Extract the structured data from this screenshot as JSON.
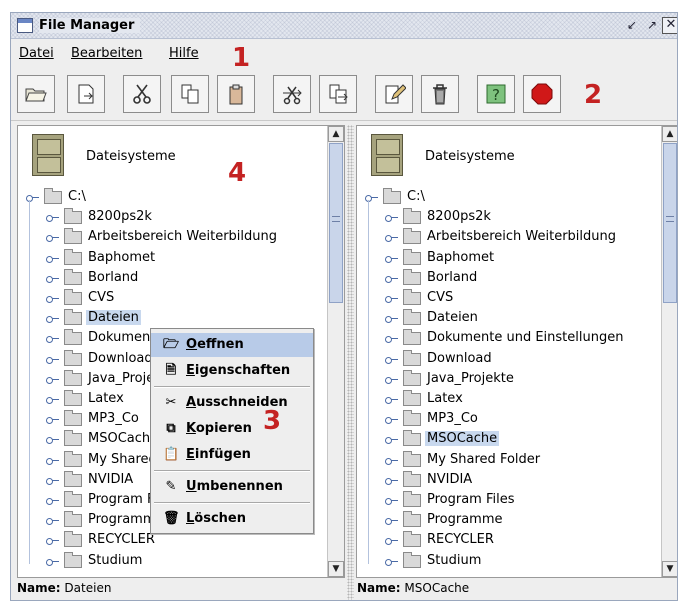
{
  "window": {
    "title": "File Manager"
  },
  "menubar": {
    "items": [
      {
        "label": "Datei"
      },
      {
        "label": "Bearbeiten"
      },
      {
        "label": "Hilfe"
      }
    ]
  },
  "callouts": [
    "1",
    "2",
    "3",
    "4"
  ],
  "toolbar": {
    "buttons": [
      {
        "icon": "open-folder-icon"
      },
      {
        "icon": "properties-icon"
      },
      {
        "icon": "cut-icon"
      },
      {
        "icon": "copy-icon"
      },
      {
        "icon": "paste-icon"
      },
      {
        "icon": "move-icon"
      },
      {
        "icon": "copy-to-icon"
      },
      {
        "icon": "rename-icon"
      },
      {
        "icon": "delete-icon"
      },
      {
        "icon": "help-icon"
      },
      {
        "icon": "stop-icon"
      }
    ]
  },
  "left_pane": {
    "root_label": "Dateisysteme",
    "drive": "C:\\",
    "folders": [
      "8200ps2k",
      "Arbeitsbereich Weiterbildung",
      "Baphomet",
      "Borland",
      "CVS",
      "Dateien",
      "Dokumente und Einstellungen",
      "Download",
      "Java_Projekte",
      "Latex",
      "MP3_Co",
      "MSOCache",
      "My Shared Folder",
      "NVIDIA",
      "Program Files",
      "Programme",
      "RECYCLER",
      "Studium"
    ],
    "selected": "Dateien",
    "status_label": "Name:",
    "status_value": "Dateien"
  },
  "right_pane": {
    "root_label": "Dateisysteme",
    "drive": "C:\\",
    "folders": [
      "8200ps2k",
      "Arbeitsbereich Weiterbildung",
      "Baphomet",
      "Borland",
      "CVS",
      "Dateien",
      "Dokumente und Einstellungen",
      "Download",
      "Java_Projekte",
      "Latex",
      "MP3_Co",
      "MSOCache",
      "My Shared Folder",
      "NVIDIA",
      "Program Files",
      "Programme",
      "RECYCLER",
      "Studium"
    ],
    "selected": "MSOCache",
    "status_label": "Name:",
    "status_value": "MSOCache"
  },
  "context_menu": {
    "items": [
      {
        "label": "Oeffnen",
        "icon": "open-folder-icon"
      },
      {
        "label": "Eigenschaften",
        "icon": "properties-icon"
      },
      {
        "label": "Ausschneiden",
        "icon": "cut-icon"
      },
      {
        "label": "Kopieren",
        "icon": "copy-icon"
      },
      {
        "label": "Einfügen",
        "icon": "paste-icon"
      },
      {
        "label": "Umbenennen",
        "icon": "rename-icon"
      },
      {
        "label": "Löschen",
        "icon": "delete-icon"
      }
    ],
    "highlighted": "Oeffnen"
  },
  "colors": {
    "selection": "#c8d8ee",
    "callout": "#c42222",
    "stop": "#d01818",
    "help": "#7ec27e"
  }
}
